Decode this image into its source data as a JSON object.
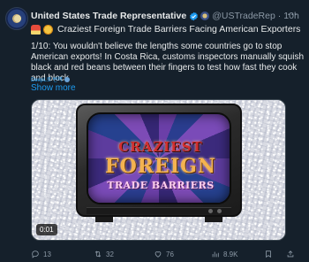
{
  "tweet": {
    "display_name": "United States Trade Representative",
    "handle": "@USTradeRep",
    "separator": "·",
    "time": "10h",
    "headline": "Craziest Foreign Trade Barriers Facing American Exporters",
    "body": "1/10: You wouldn't believe the lengths some countries go to stop American exports! In Costa Rica, customs inspectors manually squish black and red beans between their fingers to test how fast they cook and block",
    "translate_label": "DeepL로 번역",
    "show_more": "Show more",
    "media": {
      "title_line1": "CRAZIEST",
      "title_line2": "FOREIGN",
      "title_line3": "TRADE BARRIERS",
      "timestamp": "0:01"
    },
    "actions": {
      "reply_count": "13",
      "retweet_count": "32",
      "like_count": "76",
      "views_count": "8.9K"
    }
  },
  "icons": {
    "more": "more-icon",
    "verified": "verified-icon",
    "reply": "reply-icon",
    "retweet": "retweet-icon",
    "like": "like-icon",
    "views": "views-icon",
    "bookmark": "bookmark-icon",
    "share": "share-icon"
  },
  "colors": {
    "background": "#15202b",
    "text": "#e7e9ea",
    "muted": "#8b98a5",
    "link": "#1d9bf0"
  }
}
